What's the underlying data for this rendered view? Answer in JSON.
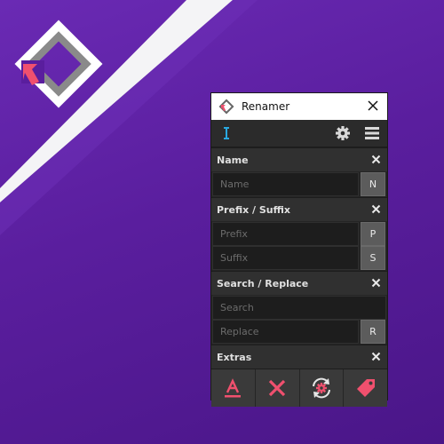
{
  "window": {
    "title": "Renamer"
  },
  "sections": {
    "name": {
      "label": "Name",
      "placeholder": "Name",
      "button": "N"
    },
    "prefix_suffix": {
      "label": "Prefix / Suffix",
      "prefix_placeholder": "Prefix",
      "prefix_button": "P",
      "suffix_placeholder": "Suffix",
      "suffix_button": "S"
    },
    "search_replace": {
      "label": "Search / Replace",
      "search_placeholder": "Search",
      "replace_placeholder": "Replace",
      "replace_button": "R"
    },
    "extras": {
      "label": "Extras"
    }
  },
  "icons": {
    "toolbar": [
      "text-cursor-icon",
      "gear-icon",
      "menu-icon"
    ],
    "extras": [
      "text-color-icon",
      "remove-icon",
      "refresh-gear-icon",
      "tag-icon"
    ]
  },
  "colors": {
    "accent": "#f0506e",
    "cursor": "#29a8e0",
    "bg": "#5a1e9e"
  }
}
